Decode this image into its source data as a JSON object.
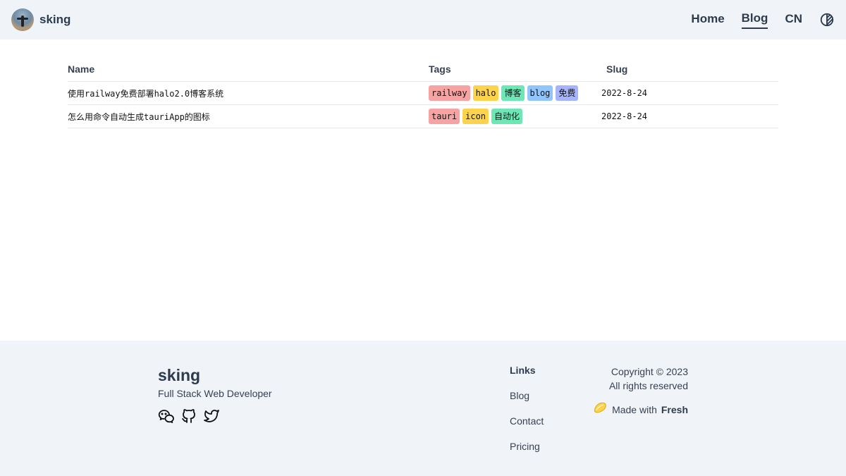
{
  "header": {
    "brand": "sking",
    "nav": [
      {
        "label": "Home",
        "active": false
      },
      {
        "label": "Blog",
        "active": true
      },
      {
        "label": "CN",
        "active": false
      }
    ]
  },
  "table": {
    "columns": [
      "Name",
      "Tags",
      "Slug"
    ],
    "rows": [
      {
        "name": "使用railway免费部署halo2.0博客系统",
        "tags": [
          {
            "label": "railway",
            "color": "#f7a3a3"
          },
          {
            "label": "halo",
            "color": "#fcd34d"
          },
          {
            "label": "博客",
            "color": "#6ee7b7"
          },
          {
            "label": "blog",
            "color": "#93c5fd"
          },
          {
            "label": "免费",
            "color": "#a5b4fc"
          }
        ],
        "slug": "2022-8-24"
      },
      {
        "name": "怎么用命令自动生成tauriApp的图标",
        "tags": [
          {
            "label": "tauri",
            "color": "#f7a3a3"
          },
          {
            "label": "icon",
            "color": "#fcd34d"
          },
          {
            "label": "自动化",
            "color": "#6ee7b7"
          }
        ],
        "slug": "2022-8-24"
      }
    ]
  },
  "footer": {
    "title": "sking",
    "subtitle": "Full Stack Web Developer",
    "links_heading": "Links",
    "links": [
      "Blog",
      "Contact",
      "Pricing"
    ],
    "copyright": "Copyright © 2023",
    "rights": "All rights reserved",
    "made_with": "Made with",
    "made_with_brand": "Fresh"
  }
}
